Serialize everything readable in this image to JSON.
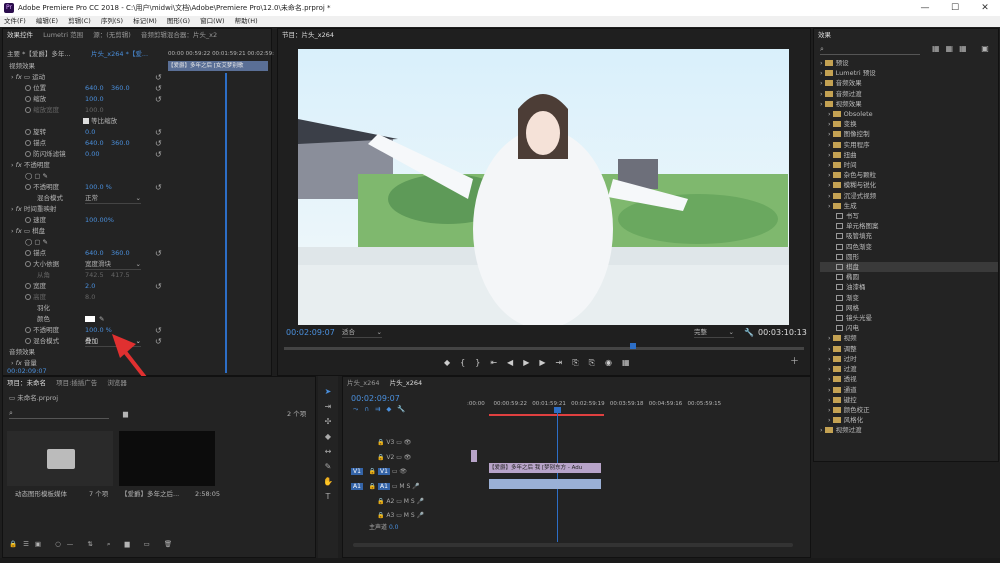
{
  "title": "Adobe Premiere Pro CC 2018 - C:\\用户\\midwi\\文档\\Adobe\\Premiere Pro\\12.0\\未命名.prproj *",
  "menu": [
    "文件(F)",
    "编辑(E)",
    "剪辑(C)",
    "序列(S)",
    "标记(M)",
    "图形(G)",
    "窗口(W)",
    "帮助(H)"
  ],
  "effect_controls": {
    "tabs": [
      "效果控件",
      "Lumetri 范围",
      "源：(无剪辑)",
      "音频剪辑混合器：片头_x2"
    ],
    "source_label": "主要 *【爱爵】多年...",
    "seq_label": "片头_x264 *【爱...",
    "timecodes": [
      "00:00",
      "00:59:22",
      "00:01:59:21",
      "00:02:59:"
    ],
    "clip_label": "【爱爵】多年之后 [女艾梦别歌",
    "video_fx": "视频效果",
    "motion": "运动",
    "position": "位置",
    "position_x": "640.0",
    "position_y": "360.0",
    "scale": "缩放",
    "scale_v": "100.0",
    "scale_w": "缩放宽度",
    "scale_w_v": "100.0",
    "uniform": "等比缩放",
    "rotation": "旋转",
    "rotation_v": "0.0",
    "anchor": "锚点",
    "anchor_x": "640.0",
    "anchor_y": "360.0",
    "flicker": "防闪烁滤镜",
    "flicker_v": "0.00",
    "opacity_h": "不透明度",
    "opacity": "不透明度",
    "opacity_v": "100.0 %",
    "blend": "混合模式",
    "blend_v": "正常",
    "time_remap": "时间重映射",
    "speed": "速度",
    "speed_v": "100.00%",
    "checker": "棋盘",
    "c_anchor": "锚点",
    "c_anchor_x": "640.0",
    "c_anchor_y": "360.0",
    "c_corner": "从角",
    "c_corner_x": "742.5",
    "c_corner_y": "417.5",
    "size_src": "大小依据",
    "size_src_v": "宽度滑块",
    "width": "宽度",
    "width_v": "2.0",
    "height": "高度",
    "height_v": "8.0",
    "feather": "羽化",
    "color": "颜色",
    "c_opacity": "不透明度",
    "c_opacity_v": "100.0 %",
    "c_blend": "混合模式",
    "c_blend_v": "叠加",
    "audio_fx": "音频效果",
    "volume": "音量",
    "current_time": "00:02:09:07"
  },
  "program": {
    "title": "节目：片头_x264",
    "timecode": "00:02:09:07",
    "fit": "适合",
    "quality": "完整",
    "duration": "00:03:10:13"
  },
  "effects": {
    "title": "效果",
    "items": [
      {
        "label": "预设",
        "indent": 0,
        "folder": true
      },
      {
        "label": "Lumetri 预设",
        "indent": 0,
        "folder": true
      },
      {
        "label": "音频效果",
        "indent": 0,
        "folder": true
      },
      {
        "label": "音频过渡",
        "indent": 0,
        "folder": true
      },
      {
        "label": "视频效果",
        "indent": 0,
        "folder": true
      },
      {
        "label": "Obsolete",
        "indent": 1,
        "folder": true
      },
      {
        "label": "变换",
        "indent": 1,
        "folder": true
      },
      {
        "label": "图像控制",
        "indent": 1,
        "folder": true
      },
      {
        "label": "实用程序",
        "indent": 1,
        "folder": true
      },
      {
        "label": "扭曲",
        "indent": 1,
        "folder": true
      },
      {
        "label": "时间",
        "indent": 1,
        "folder": true
      },
      {
        "label": "杂色与颗粒",
        "indent": 1,
        "folder": true
      },
      {
        "label": "模糊与锐化",
        "indent": 1,
        "folder": true
      },
      {
        "label": "沉浸式视频",
        "indent": 1,
        "folder": true
      },
      {
        "label": "生成",
        "indent": 1,
        "folder": true
      },
      {
        "label": "书写",
        "indent": 2,
        "folder": false
      },
      {
        "label": "单元格图案",
        "indent": 2,
        "folder": false
      },
      {
        "label": "吸管填充",
        "indent": 2,
        "folder": false
      },
      {
        "label": "四色渐变",
        "indent": 2,
        "folder": false
      },
      {
        "label": "圆形",
        "indent": 2,
        "folder": false
      },
      {
        "label": "棋盘",
        "indent": 2,
        "folder": false
      },
      {
        "label": "椭圆",
        "indent": 2,
        "folder": false
      },
      {
        "label": "油漆桶",
        "indent": 2,
        "folder": false
      },
      {
        "label": "渐变",
        "indent": 2,
        "folder": false
      },
      {
        "label": "网格",
        "indent": 2,
        "folder": false
      },
      {
        "label": "镜头光晕",
        "indent": 2,
        "folder": false
      },
      {
        "label": "闪电",
        "indent": 2,
        "folder": false
      },
      {
        "label": "视频",
        "indent": 1,
        "folder": true
      },
      {
        "label": "调整",
        "indent": 1,
        "folder": true
      },
      {
        "label": "过时",
        "indent": 1,
        "folder": true
      },
      {
        "label": "过渡",
        "indent": 1,
        "folder": true
      },
      {
        "label": "透视",
        "indent": 1,
        "folder": true
      },
      {
        "label": "通道",
        "indent": 1,
        "folder": true
      },
      {
        "label": "键控",
        "indent": 1,
        "folder": true
      },
      {
        "label": "颜色校正",
        "indent": 1,
        "folder": true
      },
      {
        "label": "风格化",
        "indent": 1,
        "folder": true
      },
      {
        "label": "视频过渡",
        "indent": 0,
        "folder": true
      }
    ]
  },
  "project": {
    "tabs": [
      "项目：未命名",
      "项目:插插广告",
      "浏览器"
    ],
    "file": "未命名.prproj",
    "count": "2 个项",
    "items": [
      {
        "name": "动态图形模板媒体",
        "meta": "7 个项"
      },
      {
        "name": "【爱爵】多年之后...",
        "meta": "2:58:05"
      }
    ]
  },
  "timeline": {
    "tabs": [
      "片头_x264",
      "片头_x264"
    ],
    "timecode": "00:02:09:07",
    "ruler": [
      ":00:00",
      "00:00:59:22",
      "00:01:59:21",
      "00:02:59:19",
      "00:03:59:18",
      "00:04:59:16",
      "00:05:59:15"
    ],
    "tracks": [
      "V3",
      "V2",
      "V1",
      "A1",
      "A2",
      "A3"
    ],
    "master": "主声道",
    "master_v": "0.0",
    "clip": "【爱爵】多年之后 我 [梦别东方 - Adu"
  }
}
